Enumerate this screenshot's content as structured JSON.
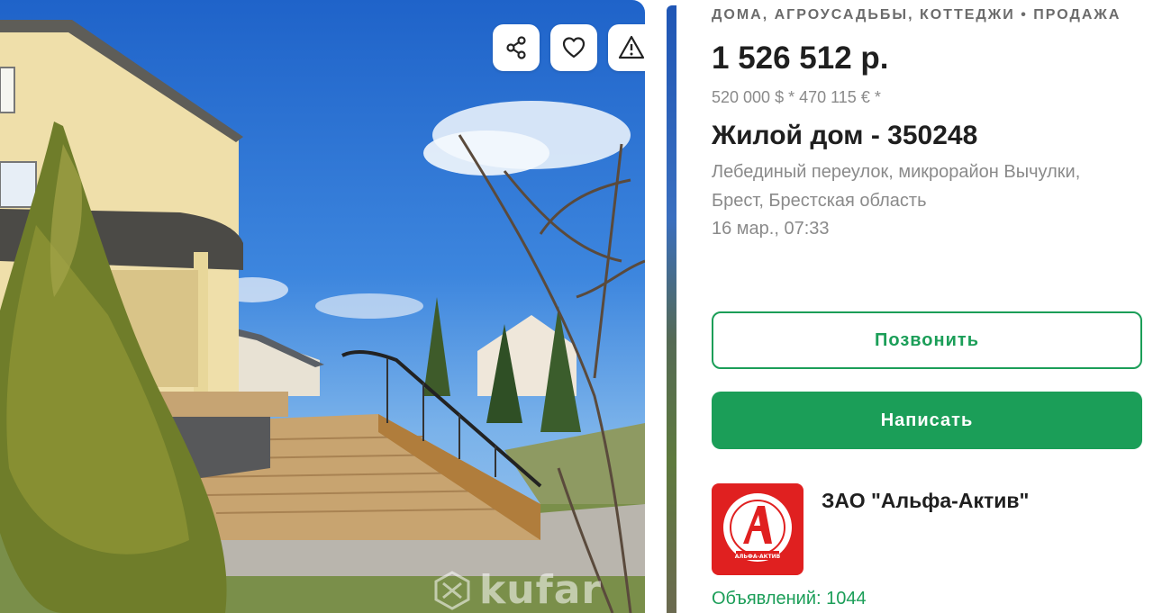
{
  "photo": {
    "actions": [
      {
        "name": "share-icon"
      },
      {
        "name": "heart-icon"
      },
      {
        "name": "warning-icon"
      }
    ],
    "watermark": "kufar"
  },
  "listing": {
    "category": "ДОМА, АГРОУСАДЬБЫ, КОТТЕДЖИ • ПРОДАЖА",
    "price": "1 526 512 р.",
    "alt_prices": "520 000 $ *  470 115 € *",
    "title": "Жилой дом - 350248",
    "address": "Лебединый переулок, микрорайон Вычулки, Брест, Брестская область",
    "date": "16 мар., 07:33"
  },
  "actions": {
    "call_label": "Позвонить",
    "write_label": "Написать"
  },
  "seller": {
    "name": "ЗАО \"Альфа-Актив\"",
    "logo_text": "АЛЬФА-АКТИВ",
    "listings_text": "Объявлений: 1044"
  },
  "colors": {
    "accent": "#1b9e58",
    "logo": "#e02020"
  }
}
